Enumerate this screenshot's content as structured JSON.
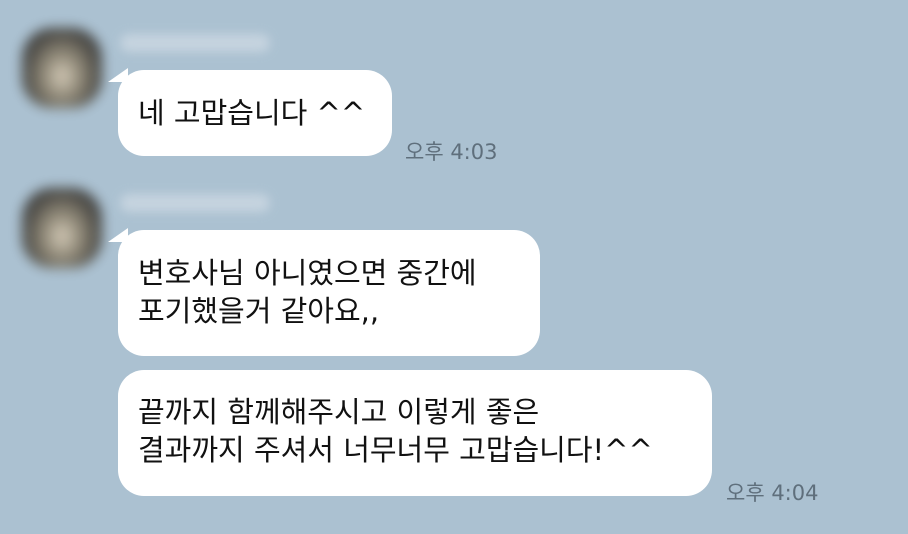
{
  "messages": [
    {
      "lines": [
        "네 고맙습니다 ^^"
      ],
      "time": "오후 4:03"
    },
    {
      "lines": [
        "변호사님 아니였으면 중간에",
        "포기했을거 같아요,,"
      ],
      "time": ""
    },
    {
      "lines": [
        "끝까지 함께해주시고 이렇게 좋은",
        "결과까지 주셔서 너무너무 고맙습니다!^^"
      ],
      "time": "오후 4:04"
    }
  ]
}
